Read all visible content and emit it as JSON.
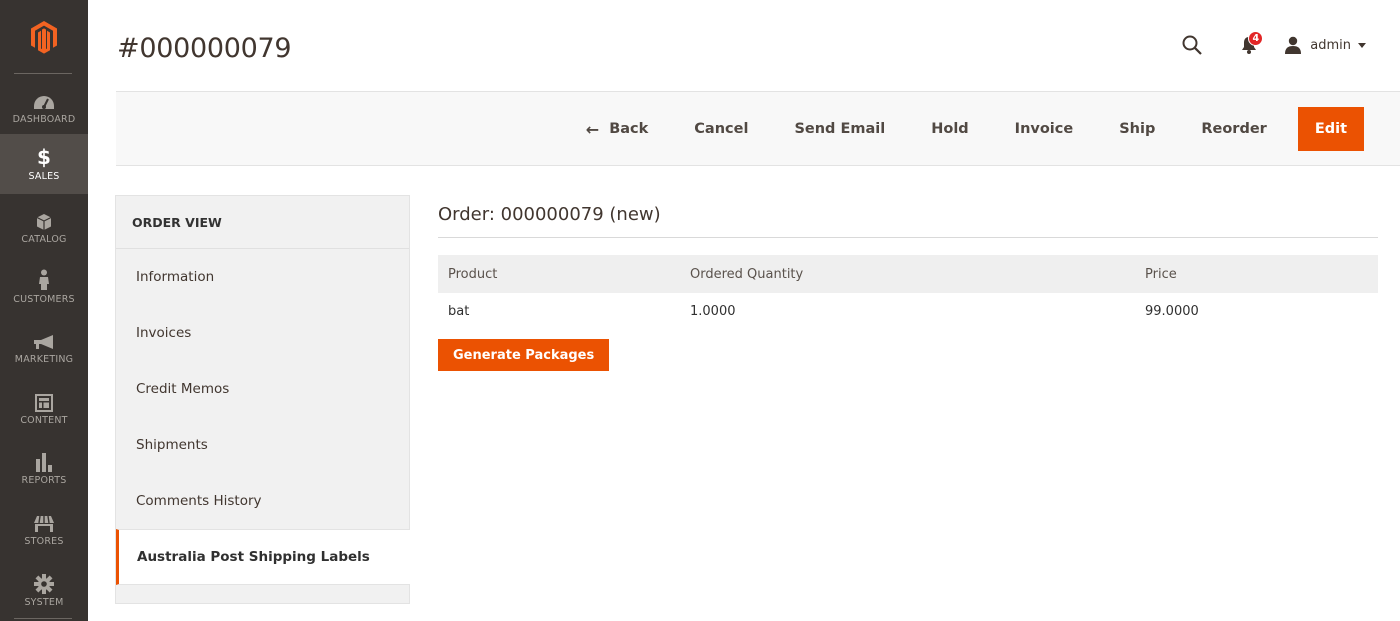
{
  "brand": {
    "accent": "#eb5202",
    "nav_bg": "#373330",
    "nav_active_bg": "#524d49"
  },
  "nav": {
    "logo": "magento-logo-icon",
    "items": [
      {
        "label": "Dashboard",
        "icon": "speedometer-icon",
        "active": false
      },
      {
        "label": "Sales",
        "icon": "dollar-icon",
        "active": true
      },
      {
        "label": "Catalog",
        "icon": "box-icon",
        "active": false
      },
      {
        "label": "Customers",
        "icon": "person-icon",
        "active": false
      },
      {
        "label": "Marketing",
        "icon": "megaphone-icon",
        "active": false
      },
      {
        "label": "Content",
        "icon": "layout-icon",
        "active": false
      },
      {
        "label": "Reports",
        "icon": "bar-chart-icon",
        "active": false
      },
      {
        "label": "Stores",
        "icon": "storefront-icon",
        "active": false
      },
      {
        "label": "System",
        "icon": "gear-icon",
        "active": false
      }
    ]
  },
  "header": {
    "title": "#000000079",
    "notifications_count": "4",
    "user_name": "admin"
  },
  "toolbar": {
    "back": "Back",
    "cancel": "Cancel",
    "send_email": "Send Email",
    "hold": "Hold",
    "invoice": "Invoice",
    "ship": "Ship",
    "reorder": "Reorder",
    "edit": "Edit"
  },
  "order_view": {
    "title": "ORDER VIEW",
    "items": [
      {
        "label": "Information",
        "active": false
      },
      {
        "label": "Invoices",
        "active": false
      },
      {
        "label": "Credit Memos",
        "active": false
      },
      {
        "label": "Shipments",
        "active": false
      },
      {
        "label": "Comments History",
        "active": false
      },
      {
        "label": "Australia Post Shipping Labels",
        "active": true
      }
    ]
  },
  "main": {
    "section_title": "Order: 000000079 (new)",
    "table": {
      "columns": [
        "Product",
        "Ordered Quantity",
        "Price"
      ],
      "rows": [
        [
          "bat",
          "1.0000",
          "99.0000"
        ]
      ]
    },
    "generate_button": "Generate Packages"
  }
}
